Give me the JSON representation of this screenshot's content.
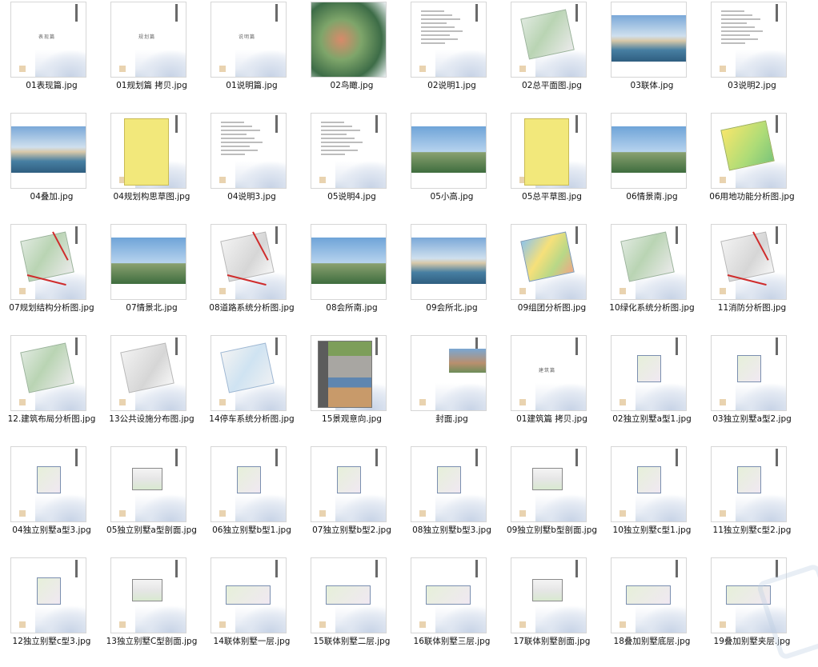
{
  "files": [
    {
      "name": "01表现篇.jpg",
      "kind": "cover-title",
      "mini": "表现篇"
    },
    {
      "name": "01规划篇 拷贝.jpg",
      "kind": "cover-title",
      "mini": "规划篇"
    },
    {
      "name": "01说明篇.jpg",
      "kind": "cover-title",
      "mini": "说明篇"
    },
    {
      "name": "02鸟瞰.jpg",
      "kind": "aerial"
    },
    {
      "name": "02说明1.jpg",
      "kind": "text-page"
    },
    {
      "name": "02总平面图.jpg",
      "kind": "site-plan"
    },
    {
      "name": "03联体.jpg",
      "kind": "water-photo"
    },
    {
      "name": "03说明2.jpg",
      "kind": "text-page"
    },
    {
      "name": "04叠加.jpg",
      "kind": "water-photo"
    },
    {
      "name": "04规划构思草图.jpg",
      "kind": "sketch"
    },
    {
      "name": "04说明3.jpg",
      "kind": "text-page"
    },
    {
      "name": "05说明4.jpg",
      "kind": "text-page"
    },
    {
      "name": "05小高.jpg",
      "kind": "photo"
    },
    {
      "name": "05总平草图.jpg",
      "kind": "sketch"
    },
    {
      "name": "06情景南.jpg",
      "kind": "photo"
    },
    {
      "name": "06用地功能分析图.jpg",
      "kind": "plan-yellow"
    },
    {
      "name": "07规划结构分析图.jpg",
      "kind": "plan-arrows"
    },
    {
      "name": "07情景北.jpg",
      "kind": "photo"
    },
    {
      "name": "08道路系统分析图.jpg",
      "kind": "plan-arrows-grey"
    },
    {
      "name": "08会所南.jpg",
      "kind": "photo"
    },
    {
      "name": "09会所北.jpg",
      "kind": "water-photo"
    },
    {
      "name": "09组团分析图.jpg",
      "kind": "plan-colorful"
    },
    {
      "name": "10绿化系统分析图.jpg",
      "kind": "plan-green"
    },
    {
      "name": "11消防分析图.jpg",
      "kind": "plan-arrows-grey"
    },
    {
      "name": "12.建筑布局分析图.jpg",
      "kind": "plan-green"
    },
    {
      "name": "13公共设施分布图.jpg",
      "kind": "plan-grey"
    },
    {
      "name": "14停车系统分析图.jpg",
      "kind": "plan-blue"
    },
    {
      "name": "15景观意向.jpg",
      "kind": "collage"
    },
    {
      "name": "封面.jpg",
      "kind": "cover"
    },
    {
      "name": "01建筑篇 拷贝.jpg",
      "kind": "cover-title",
      "mini": "建筑篇"
    },
    {
      "name": "02独立别墅a型1.jpg",
      "kind": "floor"
    },
    {
      "name": "03独立别墅a型2.jpg",
      "kind": "floor"
    },
    {
      "name": "04独立别墅a型3.jpg",
      "kind": "floor"
    },
    {
      "name": "05独立别墅a型剖面.jpg",
      "kind": "section"
    },
    {
      "name": "06独立别墅b型1.jpg",
      "kind": "floor"
    },
    {
      "name": "07独立别墅b型2.jpg",
      "kind": "floor"
    },
    {
      "name": "08独立别墅b型3.jpg",
      "kind": "floor"
    },
    {
      "name": "09独立别墅b型剖面.jpg",
      "kind": "section"
    },
    {
      "name": "10独立别墅c型1.jpg",
      "kind": "floor"
    },
    {
      "name": "11独立别墅c型2.jpg",
      "kind": "floor"
    },
    {
      "name": "12独立别墅c型3.jpg",
      "kind": "floor"
    },
    {
      "name": "13独立别墅C型剖面.jpg",
      "kind": "section"
    },
    {
      "name": "14联体别墅一层.jpg",
      "kind": "floor-wide"
    },
    {
      "name": "15联体别墅二层.jpg",
      "kind": "floor-wide"
    },
    {
      "name": "16联体别墅三层.jpg",
      "kind": "floor-wide"
    },
    {
      "name": "17联体别墅剖面.jpg",
      "kind": "section"
    },
    {
      "name": "18叠加别墅底层.jpg",
      "kind": "floor-wide"
    },
    {
      "name": "19叠加别墅夹层.jpg",
      "kind": "floor-wide"
    }
  ]
}
